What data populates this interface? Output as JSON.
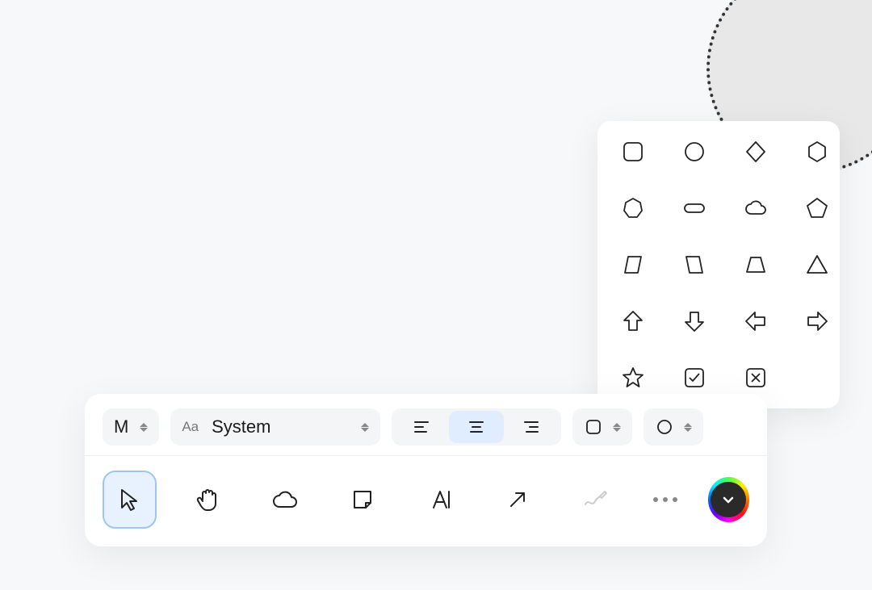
{
  "canvas": {
    "selected_shape": "cloud_outline_dotted"
  },
  "shape_picker": {
    "rows": [
      [
        "rounded-square",
        "circle",
        "diamond",
        "hexagon"
      ],
      [
        "heptagon",
        "pill",
        "cloud",
        "pentagon"
      ],
      [
        "parallelogram-left",
        "parallelogram-right",
        "trapezoid",
        "triangle"
      ],
      [
        "arrow-up",
        "arrow-down",
        "arrow-left",
        "arrow-right"
      ],
      [
        "star",
        "checkbox-checked",
        "checkbox-x",
        ""
      ]
    ]
  },
  "style_bar": {
    "size_label": "M",
    "font_prefix": "Aa",
    "font_name": "System",
    "alignment": {
      "options": [
        "left",
        "center",
        "right"
      ],
      "selected": "center"
    },
    "shape_dropdown": "rounded-square",
    "style_dropdown": "circle"
  },
  "toolbar": {
    "tools": [
      {
        "id": "select",
        "icon": "cursor",
        "selected": true
      },
      {
        "id": "hand",
        "icon": "hand",
        "selected": false
      },
      {
        "id": "cloud",
        "icon": "cloud",
        "selected": false
      },
      {
        "id": "note",
        "icon": "sticky-note",
        "selected": false
      },
      {
        "id": "text",
        "icon": "text-cursor",
        "selected": false
      },
      {
        "id": "arrow",
        "icon": "arrow-ne",
        "selected": false
      },
      {
        "id": "draw",
        "icon": "squiggle-pen",
        "selected": false,
        "dim": true
      }
    ],
    "more": "more",
    "color": {
      "accent": "rainbow",
      "expanded": false
    }
  }
}
